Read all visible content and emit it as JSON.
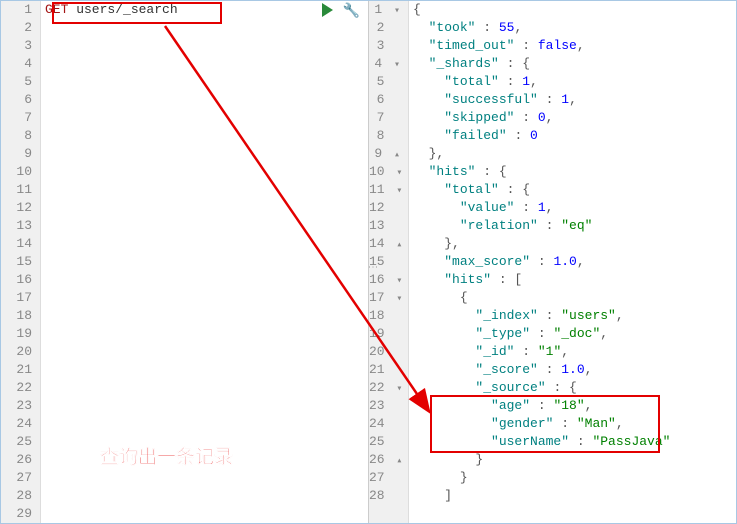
{
  "left_panel": {
    "line1": {
      "method": "GET",
      "endpoint": " users/_search"
    },
    "max_line": 29
  },
  "right_panel": {
    "lines": [
      {
        "n": 1,
        "fold": "▾",
        "indent": 0,
        "tokens": [
          {
            "t": "punct",
            "v": "{"
          }
        ]
      },
      {
        "n": 2,
        "indent": 1,
        "tokens": [
          {
            "t": "key",
            "v": "\"took\""
          },
          {
            "t": "punct",
            "v": " : "
          },
          {
            "t": "number",
            "v": "55"
          },
          {
            "t": "punct",
            "v": ","
          }
        ]
      },
      {
        "n": 3,
        "indent": 1,
        "tokens": [
          {
            "t": "key",
            "v": "\"timed_out\""
          },
          {
            "t": "punct",
            "v": " : "
          },
          {
            "t": "bool",
            "v": "false"
          },
          {
            "t": "punct",
            "v": ","
          }
        ]
      },
      {
        "n": 4,
        "fold": "▾",
        "indent": 1,
        "tokens": [
          {
            "t": "key",
            "v": "\"_shards\""
          },
          {
            "t": "punct",
            "v": " : {"
          }
        ]
      },
      {
        "n": 5,
        "indent": 2,
        "tokens": [
          {
            "t": "key",
            "v": "\"total\""
          },
          {
            "t": "punct",
            "v": " : "
          },
          {
            "t": "number",
            "v": "1"
          },
          {
            "t": "punct",
            "v": ","
          }
        ]
      },
      {
        "n": 6,
        "indent": 2,
        "tokens": [
          {
            "t": "key",
            "v": "\"successful\""
          },
          {
            "t": "punct",
            "v": " : "
          },
          {
            "t": "number",
            "v": "1"
          },
          {
            "t": "punct",
            "v": ","
          }
        ]
      },
      {
        "n": 7,
        "indent": 2,
        "tokens": [
          {
            "t": "key",
            "v": "\"skipped\""
          },
          {
            "t": "punct",
            "v": " : "
          },
          {
            "t": "number",
            "v": "0"
          },
          {
            "t": "punct",
            "v": ","
          }
        ]
      },
      {
        "n": 8,
        "indent": 2,
        "tokens": [
          {
            "t": "key",
            "v": "\"failed\""
          },
          {
            "t": "punct",
            "v": " : "
          },
          {
            "t": "number",
            "v": "0"
          }
        ]
      },
      {
        "n": 9,
        "fold": "▴",
        "indent": 1,
        "tokens": [
          {
            "t": "punct",
            "v": "},"
          }
        ]
      },
      {
        "n": 10,
        "fold": "▾",
        "indent": 1,
        "tokens": [
          {
            "t": "key",
            "v": "\"hits\""
          },
          {
            "t": "punct",
            "v": " : {"
          }
        ]
      },
      {
        "n": 11,
        "fold": "▾",
        "indent": 2,
        "tokens": [
          {
            "t": "key",
            "v": "\"total\""
          },
          {
            "t": "punct",
            "v": " : {"
          }
        ]
      },
      {
        "n": 12,
        "indent": 3,
        "tokens": [
          {
            "t": "key",
            "v": "\"value\""
          },
          {
            "t": "punct",
            "v": " : "
          },
          {
            "t": "number",
            "v": "1"
          },
          {
            "t": "punct",
            "v": ","
          }
        ]
      },
      {
        "n": 13,
        "indent": 3,
        "tokens": [
          {
            "t": "key",
            "v": "\"relation\""
          },
          {
            "t": "punct",
            "v": " : "
          },
          {
            "t": "string",
            "v": "\"eq\""
          }
        ]
      },
      {
        "n": 14,
        "fold": "▴",
        "indent": 2,
        "tokens": [
          {
            "t": "punct",
            "v": "},"
          }
        ]
      },
      {
        "n": 15,
        "indent": 2,
        "tokens": [
          {
            "t": "key",
            "v": "\"max_score\""
          },
          {
            "t": "punct",
            "v": " : "
          },
          {
            "t": "number",
            "v": "1.0"
          },
          {
            "t": "punct",
            "v": ","
          }
        ]
      },
      {
        "n": 16,
        "fold": "▾",
        "indent": 2,
        "tokens": [
          {
            "t": "key",
            "v": "\"hits\""
          },
          {
            "t": "punct",
            "v": " : ["
          }
        ]
      },
      {
        "n": 17,
        "fold": "▾",
        "indent": 3,
        "tokens": [
          {
            "t": "punct",
            "v": "{"
          }
        ]
      },
      {
        "n": 18,
        "indent": 4,
        "tokens": [
          {
            "t": "key",
            "v": "\"_index\""
          },
          {
            "t": "punct",
            "v": " : "
          },
          {
            "t": "string",
            "v": "\"users\""
          },
          {
            "t": "punct",
            "v": ","
          }
        ]
      },
      {
        "n": 19,
        "indent": 4,
        "tokens": [
          {
            "t": "key",
            "v": "\"_type\""
          },
          {
            "t": "punct",
            "v": " : "
          },
          {
            "t": "string",
            "v": "\"_doc\""
          },
          {
            "t": "punct",
            "v": ","
          }
        ]
      },
      {
        "n": 20,
        "indent": 4,
        "tokens": [
          {
            "t": "key",
            "v": "\"_id\""
          },
          {
            "t": "punct",
            "v": " : "
          },
          {
            "t": "string",
            "v": "\"1\""
          },
          {
            "t": "punct",
            "v": ","
          }
        ]
      },
      {
        "n": 21,
        "indent": 4,
        "tokens": [
          {
            "t": "key",
            "v": "\"_score\""
          },
          {
            "t": "punct",
            "v": " : "
          },
          {
            "t": "number",
            "v": "1.0"
          },
          {
            "t": "punct",
            "v": ","
          }
        ]
      },
      {
        "n": 22,
        "fold": "▾",
        "indent": 4,
        "tokens": [
          {
            "t": "key",
            "v": "\"_source\""
          },
          {
            "t": "punct",
            "v": " : {"
          }
        ]
      },
      {
        "n": 23,
        "indent": 5,
        "tokens": [
          {
            "t": "key",
            "v": "\"age\""
          },
          {
            "t": "punct",
            "v": " : "
          },
          {
            "t": "string",
            "v": "\"18\""
          },
          {
            "t": "punct",
            "v": ","
          }
        ]
      },
      {
        "n": 24,
        "indent": 5,
        "tokens": [
          {
            "t": "key",
            "v": "\"gender\""
          },
          {
            "t": "punct",
            "v": " : "
          },
          {
            "t": "string",
            "v": "\"Man\""
          },
          {
            "t": "punct",
            "v": ","
          }
        ]
      },
      {
        "n": 25,
        "indent": 5,
        "tokens": [
          {
            "t": "key",
            "v": "\"userName\""
          },
          {
            "t": "punct",
            "v": " : "
          },
          {
            "t": "string",
            "v": "\"PassJava\""
          }
        ]
      },
      {
        "n": 26,
        "fold": "▴",
        "indent": 4,
        "tokens": [
          {
            "t": "punct",
            "v": "}"
          }
        ]
      },
      {
        "n": 27,
        "indent": 3,
        "tokens": [
          {
            "t": "punct",
            "v": "}"
          }
        ]
      },
      {
        "n": 28,
        "indent": 2,
        "tokens": [
          {
            "t": "punct",
            "v": "]"
          }
        ]
      }
    ]
  },
  "annotation": "查询出一条记录"
}
